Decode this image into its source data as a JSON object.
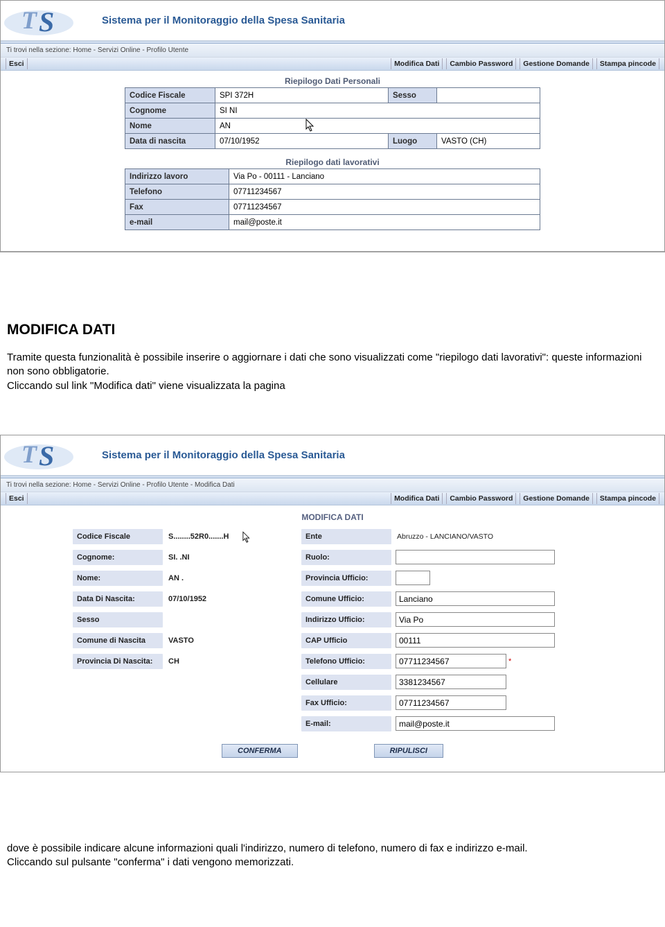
{
  "common": {
    "app_title": "Sistema per il Monitoraggio della Spesa Sanitaria",
    "breadcrumb_prefix": "Ti trovi nella sezione:",
    "esci": "Esci"
  },
  "nav": {
    "modifica_dati": "Modifica Dati",
    "cambio_password": "Cambio Password",
    "gestione_domande": "Gestione Domande",
    "stampa_pincode": "Stampa pincode"
  },
  "shot1": {
    "breadcrumb": "Home - Servizi Online - Profilo Utente",
    "sec1_title": "Riepilogo Dati Personali",
    "labels": {
      "codice_fiscale": "Codice Fiscale",
      "sesso": "Sesso",
      "cognome": "Cognome",
      "nome": "Nome",
      "data_nascita": "Data di nascita",
      "luogo": "Luogo"
    },
    "values": {
      "codice_fiscale": "SPI           372H",
      "sesso": "",
      "cognome": "SI        NI",
      "nome": "AN    ",
      "data_nascita": "07/10/1952",
      "luogo": "VASTO (CH)"
    },
    "sec2_title": "Riepilogo dati lavorativi",
    "labels2": {
      "indirizzo_lavoro": "Indirizzo lavoro",
      "telefono": "Telefono",
      "fax": "Fax",
      "email": "e-mail"
    },
    "values2": {
      "indirizzo_lavoro": "Via Po - 00111 - Lanciano",
      "telefono": "07711234567",
      "fax": "07711234567",
      "email": "mail@poste.it"
    }
  },
  "doc": {
    "heading": "MODIFICA DATI",
    "p1": "Tramite questa funzionalità è possibile inserire o aggiornare i dati che sono visualizzati come \"riepilogo dati lavorativi\": queste informazioni non sono obbligatorie.",
    "p2": "Cliccando sul link \"Modifica dati\" viene visualizzata la pagina",
    "p3": "dove è possibile indicare alcune informazioni quali l'indirizzo, numero di telefono, numero di fax e indirizzo e-mail.",
    "p4": "Cliccando sul pulsante \"conferma\" i dati vengono memorizzati."
  },
  "shot2": {
    "breadcrumb": "Home - Servizi Online - Profilo Utente - Modifica Dati",
    "title": "MODIFICA DATI",
    "left_labels": {
      "codice_fiscale": "Codice Fiscale",
      "cognome": "Cognome:",
      "nome": "Nome:",
      "data_nascita": "Data Di Nascita:",
      "sesso": "Sesso",
      "comune_nascita": "Comune di Nascita",
      "provincia_nascita": "Provincia Di Nascita:"
    },
    "left_values": {
      "codice_fiscale": "S........52R0.......H",
      "cognome": "SI.      .NI",
      "nome": "AN     .",
      "data_nascita": "07/10/1952",
      "sesso": "",
      "comune_nascita": "VASTO",
      "provincia_nascita": "CH"
    },
    "right_labels": {
      "ente": "Ente",
      "ruolo": "Ruolo:",
      "provincia_ufficio": "Provincia Ufficio:",
      "comune_ufficio": "Comune Ufficio:",
      "indirizzo_ufficio": "Indirizzo Ufficio:",
      "cap_ufficio": "CAP Ufficio",
      "telefono_ufficio": "Telefono Ufficio:",
      "cellulare": "Cellulare",
      "fax_ufficio": "Fax Ufficio:",
      "email": "E-mail:"
    },
    "right_values": {
      "ente": "Abruzzo - LANCIANO/VASTO",
      "ruolo": "",
      "provincia_ufficio": "",
      "comune_ufficio": "Lanciano",
      "indirizzo_ufficio": "Via Po",
      "cap_ufficio": "00111",
      "telefono_ufficio": "07711234567",
      "cellulare": "3381234567",
      "fax_ufficio": "07711234567",
      "email": "mail@poste.it"
    },
    "buttons": {
      "conferma": "CONFERMA",
      "ripulisci": "RIPULISCI"
    }
  }
}
